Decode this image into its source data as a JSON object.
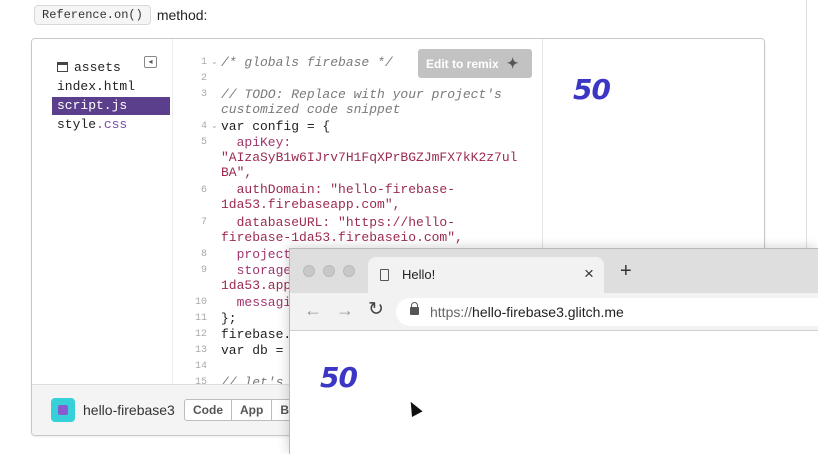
{
  "page": {
    "code_chip": "Reference.on()",
    "after_chip": "method:"
  },
  "editor": {
    "files": [
      {
        "name": "assets",
        "icon": "assets-box-icon"
      },
      {
        "name": "index.html"
      },
      {
        "name": "script.js",
        "active": true
      },
      {
        "name": "style.css"
      }
    ],
    "remix_label": "Edit to remix",
    "preview_value": "50",
    "line_numbers": [
      "1",
      "2",
      "3",
      "4",
      "5",
      "6",
      "7",
      "8",
      "9",
      "10",
      "11",
      "12",
      "13",
      "14",
      "15"
    ],
    "code": {
      "l1": "/* globals firebase */",
      "l3a": "// TODO: Replace with your project's",
      "l3b": "customized code snippet",
      "l4": "var config = {",
      "l5a": "  apiKey:",
      "l5b": "\"AIzaSyB1w6IJrv7H1FqXPrBGZJmFX7kK2z7ul",
      "l5c": "BA\",",
      "l6a": "  authDomain: \"hello-firebase-",
      "l6b": "1da53.firebaseapp.com\",",
      "l7a": "  databaseURL: \"https://hello-",
      "l7b": "firebase-1da53.firebaseio.com\",",
      "l8": "  project",
      "l9a": "  storage",
      "l9b": "1da53.app",
      "l10": "  messagi",
      "l11": "};",
      "l12": "firebase.",
      "l13": "var db =",
      "l15": "// let's"
    },
    "project_name": "hello-firebase3",
    "bottom_tabs": [
      "Code",
      "App",
      "Bo"
    ]
  },
  "browser": {
    "tab_title": "Hello!",
    "url_scheme": "https://",
    "url_host": "hello-firebase3.glitch.me",
    "page_value": "50"
  },
  "colors": {
    "accent_purple": "#5b3f8c",
    "number_blue": "#3b36c4",
    "avatar_teal": "#35d0d8"
  }
}
